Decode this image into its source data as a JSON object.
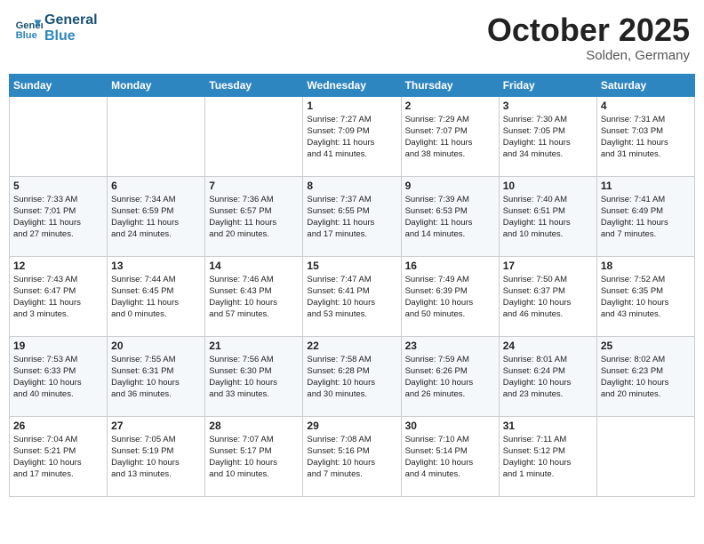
{
  "header": {
    "logo_line1": "General",
    "logo_line2": "Blue",
    "month": "October 2025",
    "location": "Solden, Germany"
  },
  "weekdays": [
    "Sunday",
    "Monday",
    "Tuesday",
    "Wednesday",
    "Thursday",
    "Friday",
    "Saturday"
  ],
  "weeks": [
    [
      {
        "day": "",
        "info": ""
      },
      {
        "day": "",
        "info": ""
      },
      {
        "day": "",
        "info": ""
      },
      {
        "day": "1",
        "info": "Sunrise: 7:27 AM\nSunset: 7:09 PM\nDaylight: 11 hours\nand 41 minutes."
      },
      {
        "day": "2",
        "info": "Sunrise: 7:29 AM\nSunset: 7:07 PM\nDaylight: 11 hours\nand 38 minutes."
      },
      {
        "day": "3",
        "info": "Sunrise: 7:30 AM\nSunset: 7:05 PM\nDaylight: 11 hours\nand 34 minutes."
      },
      {
        "day": "4",
        "info": "Sunrise: 7:31 AM\nSunset: 7:03 PM\nDaylight: 11 hours\nand 31 minutes."
      }
    ],
    [
      {
        "day": "5",
        "info": "Sunrise: 7:33 AM\nSunset: 7:01 PM\nDaylight: 11 hours\nand 27 minutes."
      },
      {
        "day": "6",
        "info": "Sunrise: 7:34 AM\nSunset: 6:59 PM\nDaylight: 11 hours\nand 24 minutes."
      },
      {
        "day": "7",
        "info": "Sunrise: 7:36 AM\nSunset: 6:57 PM\nDaylight: 11 hours\nand 20 minutes."
      },
      {
        "day": "8",
        "info": "Sunrise: 7:37 AM\nSunset: 6:55 PM\nDaylight: 11 hours\nand 17 minutes."
      },
      {
        "day": "9",
        "info": "Sunrise: 7:39 AM\nSunset: 6:53 PM\nDaylight: 11 hours\nand 14 minutes."
      },
      {
        "day": "10",
        "info": "Sunrise: 7:40 AM\nSunset: 6:51 PM\nDaylight: 11 hours\nand 10 minutes."
      },
      {
        "day": "11",
        "info": "Sunrise: 7:41 AM\nSunset: 6:49 PM\nDaylight: 11 hours\nand 7 minutes."
      }
    ],
    [
      {
        "day": "12",
        "info": "Sunrise: 7:43 AM\nSunset: 6:47 PM\nDaylight: 11 hours\nand 3 minutes."
      },
      {
        "day": "13",
        "info": "Sunrise: 7:44 AM\nSunset: 6:45 PM\nDaylight: 11 hours\nand 0 minutes."
      },
      {
        "day": "14",
        "info": "Sunrise: 7:46 AM\nSunset: 6:43 PM\nDaylight: 10 hours\nand 57 minutes."
      },
      {
        "day": "15",
        "info": "Sunrise: 7:47 AM\nSunset: 6:41 PM\nDaylight: 10 hours\nand 53 minutes."
      },
      {
        "day": "16",
        "info": "Sunrise: 7:49 AM\nSunset: 6:39 PM\nDaylight: 10 hours\nand 50 minutes."
      },
      {
        "day": "17",
        "info": "Sunrise: 7:50 AM\nSunset: 6:37 PM\nDaylight: 10 hours\nand 46 minutes."
      },
      {
        "day": "18",
        "info": "Sunrise: 7:52 AM\nSunset: 6:35 PM\nDaylight: 10 hours\nand 43 minutes."
      }
    ],
    [
      {
        "day": "19",
        "info": "Sunrise: 7:53 AM\nSunset: 6:33 PM\nDaylight: 10 hours\nand 40 minutes."
      },
      {
        "day": "20",
        "info": "Sunrise: 7:55 AM\nSunset: 6:31 PM\nDaylight: 10 hours\nand 36 minutes."
      },
      {
        "day": "21",
        "info": "Sunrise: 7:56 AM\nSunset: 6:30 PM\nDaylight: 10 hours\nand 33 minutes."
      },
      {
        "day": "22",
        "info": "Sunrise: 7:58 AM\nSunset: 6:28 PM\nDaylight: 10 hours\nand 30 minutes."
      },
      {
        "day": "23",
        "info": "Sunrise: 7:59 AM\nSunset: 6:26 PM\nDaylight: 10 hours\nand 26 minutes."
      },
      {
        "day": "24",
        "info": "Sunrise: 8:01 AM\nSunset: 6:24 PM\nDaylight: 10 hours\nand 23 minutes."
      },
      {
        "day": "25",
        "info": "Sunrise: 8:02 AM\nSunset: 6:23 PM\nDaylight: 10 hours\nand 20 minutes."
      }
    ],
    [
      {
        "day": "26",
        "info": "Sunrise: 7:04 AM\nSunset: 5:21 PM\nDaylight: 10 hours\nand 17 minutes."
      },
      {
        "day": "27",
        "info": "Sunrise: 7:05 AM\nSunset: 5:19 PM\nDaylight: 10 hours\nand 13 minutes."
      },
      {
        "day": "28",
        "info": "Sunrise: 7:07 AM\nSunset: 5:17 PM\nDaylight: 10 hours\nand 10 minutes."
      },
      {
        "day": "29",
        "info": "Sunrise: 7:08 AM\nSunset: 5:16 PM\nDaylight: 10 hours\nand 7 minutes."
      },
      {
        "day": "30",
        "info": "Sunrise: 7:10 AM\nSunset: 5:14 PM\nDaylight: 10 hours\nand 4 minutes."
      },
      {
        "day": "31",
        "info": "Sunrise: 7:11 AM\nSunset: 5:12 PM\nDaylight: 10 hours\nand 1 minute."
      },
      {
        "day": "",
        "info": ""
      }
    ]
  ]
}
